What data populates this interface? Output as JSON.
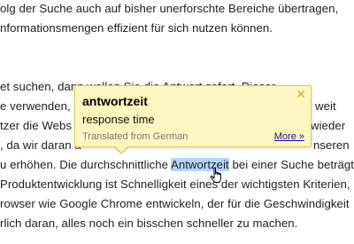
{
  "article": {
    "lines": [
      "olg der Suche auch auf bisher unerforschte Bereiche übertragen,",
      "nformationsmengen effizient für sich nutzen können.",
      "et suchen, dann wollen Sie die Antwort sofort. Dieser",
      "e verwenden, g",
      "tzer die Webs",
      ", da wir daran a",
      "u erhöhen. Die durchschnittliche ",
      "Produktentwicklung ist Schnelligkeit eines der wichtigsten Kriterien,",
      "rowser wie Google Chrome entwickeln, der für die Geschwindigkeit",
      "rlich daran, alles noch ein bisschen schneller zu machen."
    ],
    "right_fragments": [
      "weit",
      "wieder",
      "nseren"
    ],
    "highlighted_word": "Antwortzeit",
    "after_highlight": " bei einer Suche beträgt"
  },
  "popup": {
    "word": "antwortzeit",
    "translation": "response time",
    "source": "Translated from German",
    "more_label": "More »",
    "close_glyph": "✕"
  },
  "colors": {
    "popup_background": "#fdf6c0",
    "popup_border": "#dbc96a",
    "highlight": "#b5d5ff",
    "link": "#1a0dab"
  },
  "icons": {
    "close": "close-icon",
    "cursor": "hand-pointer-cursor-icon"
  }
}
